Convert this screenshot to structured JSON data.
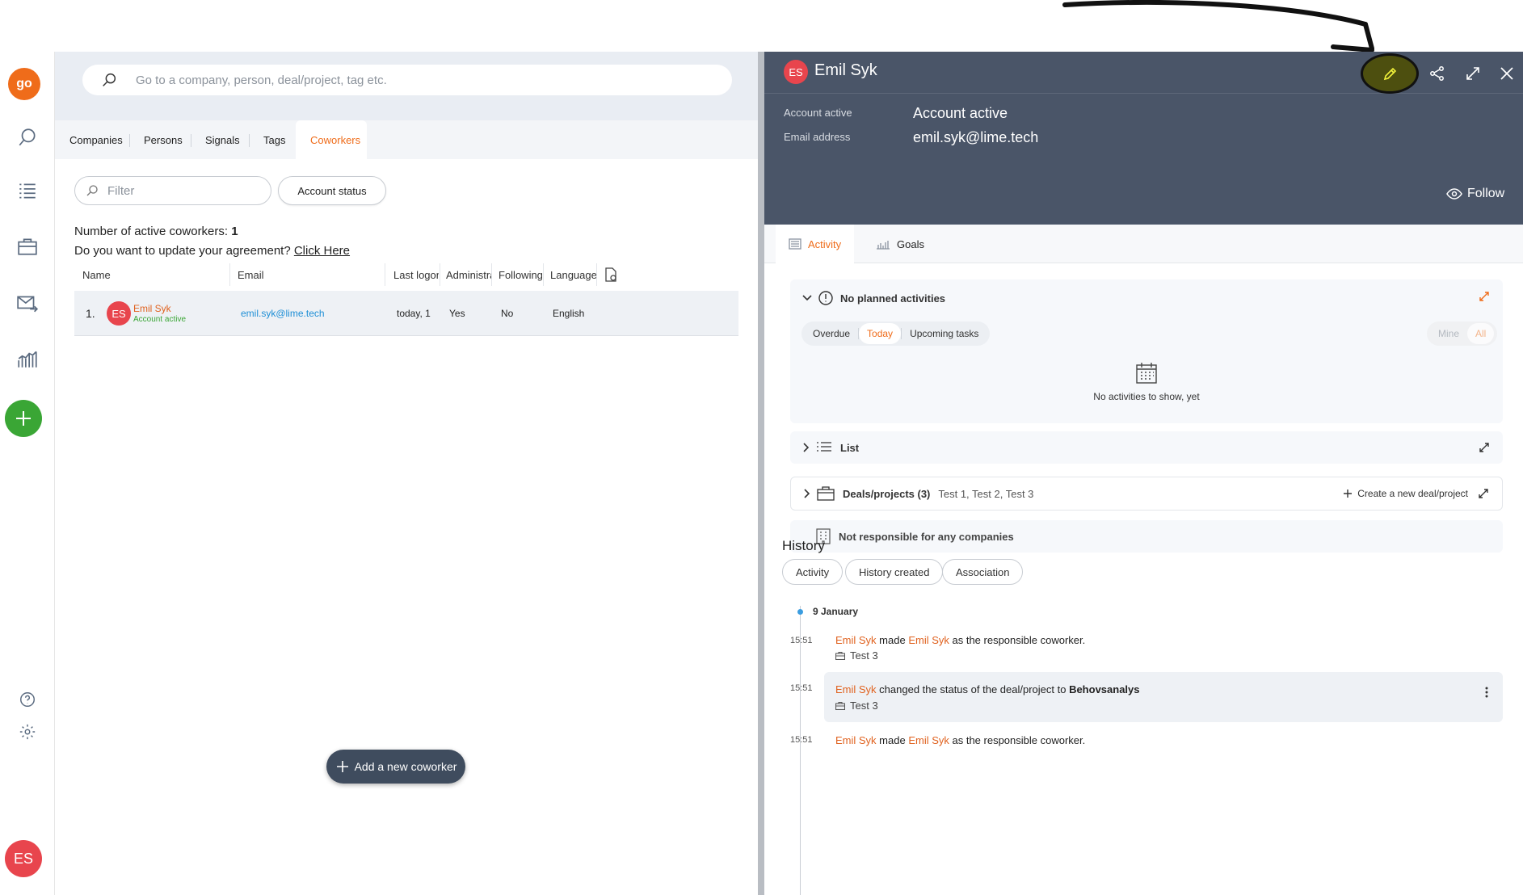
{
  "app": {
    "logo_text": "go",
    "user_initials": "ES"
  },
  "search": {
    "placeholder": "Go to a company, person, deal/project, tag etc."
  },
  "tabs": [
    {
      "label": "Companies"
    },
    {
      "label": "Persons"
    },
    {
      "label": "Signals"
    },
    {
      "label": "Tags"
    },
    {
      "label": "Coworkers"
    }
  ],
  "list": {
    "filter_placeholder": "Filter",
    "account_status_label": "Account status",
    "count_prefix": "Number of active coworkers: ",
    "count_value": "1",
    "agreement_prefix": "Do you want to update your agreement? ",
    "agreement_link": "Click Here",
    "columns": [
      "Name",
      "Email",
      "Last logon",
      "Administra",
      "Following",
      "Language"
    ],
    "rows": [
      {
        "index": "1.",
        "initials": "ES",
        "name": "Emil Syk",
        "status": "Account active",
        "email": "emil.syk@lime.tech",
        "last_logon": "today, 1",
        "admin": "Yes",
        "following": "No",
        "language": "English"
      }
    ],
    "add_button": "Add a new coworker"
  },
  "detail": {
    "initials": "ES",
    "name": "Emil Syk",
    "fields": [
      {
        "label": "Account active",
        "value": "Account active"
      },
      {
        "label": "Email address",
        "value": "emil.syk@lime.tech"
      }
    ],
    "follow_label": "Follow",
    "tabs": [
      {
        "label": "Activity"
      },
      {
        "label": "Goals"
      }
    ],
    "planned": {
      "title": "No planned activities",
      "segments": [
        "Overdue",
        "Today",
        "Upcoming tasks"
      ],
      "scope": [
        "Mine",
        "All"
      ],
      "empty_text": "No activities to show, yet"
    },
    "list_card": {
      "title": "List"
    },
    "deals_card": {
      "title": "Deals/projects (3)",
      "items": "Test 1, Test 2, Test 3",
      "create_label": "Create a new deal/project"
    },
    "companies_card": {
      "title": "Not responsible for any companies"
    },
    "history": {
      "title": "History",
      "filters": [
        "Activity",
        "History created",
        "Association"
      ],
      "date": "9 January",
      "entries": [
        {
          "time": "15:51",
          "actor": "Emil Syk",
          "verb": " made ",
          "target": "Emil Syk",
          "rest": " as the responsible coworker.",
          "sub": "Test 3"
        },
        {
          "time": "15:51",
          "actor": "Emil Syk",
          "verb": " changed the status of the deal/project to ",
          "target": "Behovsanalys",
          "rest": "",
          "sub": "Test 3"
        },
        {
          "time": "15:51",
          "actor": "Emil Syk",
          "verb": " made ",
          "target": "Emil Syk",
          "rest": " as the responsible coworker.",
          "sub": ""
        }
      ]
    }
  },
  "colors": {
    "accent": "#ef6c1a",
    "header": "#4a5568",
    "add_green": "#3aa635",
    "avatar_red": "#e8454d"
  }
}
